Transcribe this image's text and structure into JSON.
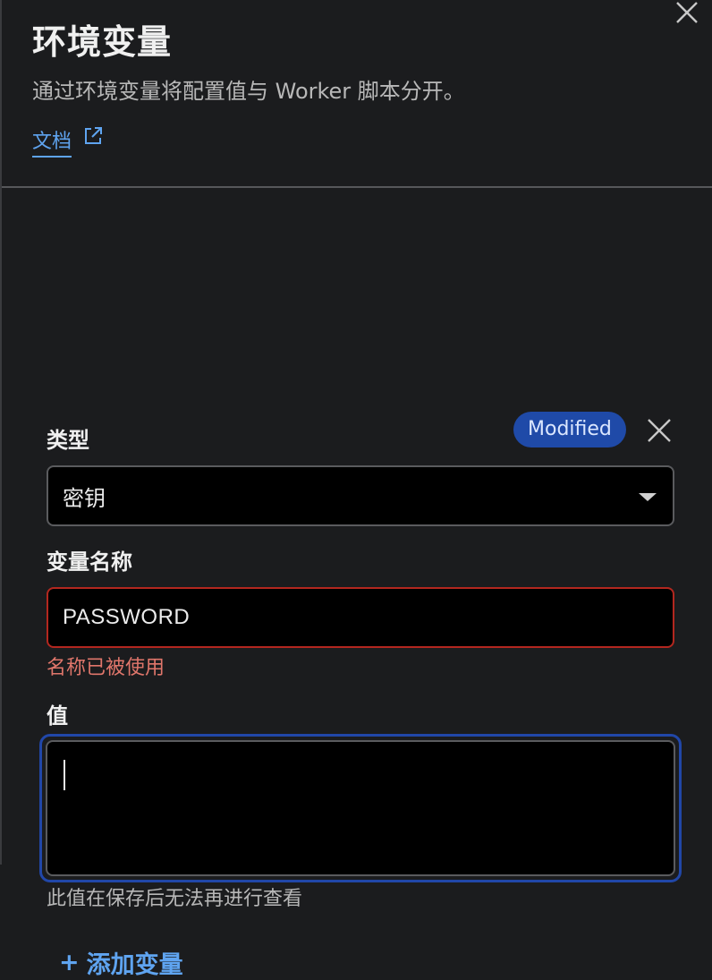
{
  "header": {
    "title": "环境变量",
    "subtitle": "通过环境变量将配置值与 Worker 脚本分开。",
    "docs_link": "文档"
  },
  "variable": {
    "badge": "Modified",
    "type_label": "类型",
    "type_value": "密钥",
    "name_label": "变量名称",
    "name_value": "PASSWORD",
    "name_error": "名称已被使用",
    "value_label": "值",
    "value_value": "",
    "value_hint": "此值在保存后无法再进行查看"
  },
  "actions": {
    "add_plus": "+",
    "add_label": "添加变量"
  },
  "colors": {
    "accent": "#5fa4f0",
    "badge_bg": "#1f4aa8",
    "error": "#e0766b",
    "focus_ring": "#2147a8"
  },
  "icons": {
    "close": "close-icon",
    "external": "external-link-icon",
    "caret": "chevron-down-icon"
  }
}
